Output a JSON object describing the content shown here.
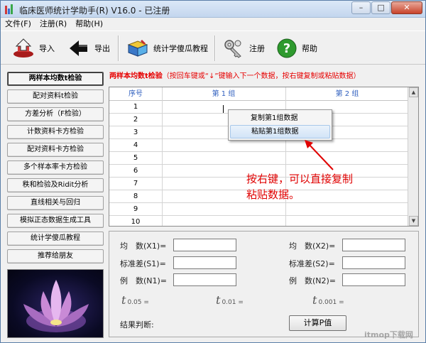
{
  "window": {
    "title": "临床医师统计学助手(R) V16.0 - 已注册"
  },
  "titlebar": {
    "minimize": "–",
    "maximize": "□",
    "close": "✕"
  },
  "menu": [
    "文件(F)",
    "注册(R)",
    "帮助(H)"
  ],
  "toolbar": {
    "import_label": "导入",
    "export_label": "导出",
    "tutorial_label": "统计学傻瓜教程",
    "register_label": "注册",
    "help_label": "帮助",
    "help_glyph": "?"
  },
  "nav": [
    "两样本均数t检验",
    "配对资料t检验",
    "方差分析（F检验）",
    "计数资料卡方检验",
    "配对资料卡方检验",
    "多个样本率卡方检验",
    "秩和检验及Ridit分析",
    "直线相关与回归",
    "模拟正态数据生成工具",
    "统计学傻瓜教程",
    "推荐给朋友"
  ],
  "heading": {
    "title": "两样本均数t检验",
    "hint": "（按回车键或“↓”键输入下一个数据，按右键复制或粘贴数据）"
  },
  "grid": {
    "headers": [
      "序号",
      "第 1 组",
      "第 2 组"
    ],
    "rows": [
      "1",
      "2",
      "3",
      "4",
      "5",
      "6",
      "7",
      "8",
      "9",
      "10"
    ]
  },
  "context_menu": [
    "复制第1组数据",
    "粘贴第1组数据"
  ],
  "annotation": [
    "按右键，可以直接复制",
    "粘贴数据。"
  ],
  "stats": {
    "mean1": "均　数(X1)=",
    "sd1": "标准差(S1)=",
    "n1": "例　数(N1)=",
    "mean2": "均　数(X2)=",
    "sd2": "标准差(S2)=",
    "n2": "例　数(N2)=",
    "t_symbol": "t",
    "t05_sub": "0.05 =",
    "t01_sub": "0.01 =",
    "t001_sub": "0.001 =",
    "result_label": "结果判断:",
    "calc_button": "计算P值"
  },
  "watermark": "itmop下载网",
  "colors": {
    "accent_red": "#e60000",
    "header_blue": "#2f5fbf",
    "title_bar": "#c3d6ee"
  }
}
